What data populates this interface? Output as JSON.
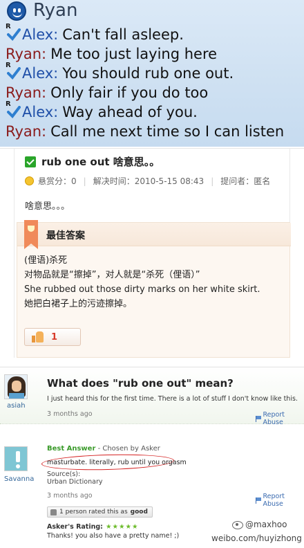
{
  "chat": {
    "title": "Ryan",
    "lines": [
      {
        "who": "Alex:",
        "text": "Can't fall asleep.",
        "verified": true
      },
      {
        "who": "Ryan:",
        "text": "Me too  just laying  here",
        "verified": false
      },
      {
        "who": "Alex:",
        "text": "You should rub one out.",
        "verified": true
      },
      {
        "who": "Ryan:",
        "text": "Only  fair  if  you  do  too",
        "verified": false
      },
      {
        "who": "Alex:",
        "text": "Way ahead  of  you.",
        "verified": true
      },
      {
        "who": "Ryan:",
        "text": "Call me next time so I can listen",
        "verified": false
      }
    ],
    "check_letter": "R",
    "colors": {
      "alex": "#1f4fa8",
      "ryan": "#8a1b1b",
      "background": "#cfe1f2"
    }
  },
  "baidu": {
    "question_title": "rub one out 啥意思。。",
    "bounty_label": "悬赏分：0",
    "solved_time": "解决时间：2010-5-15 08:43",
    "asker": "提问者：匿名",
    "question_body": "啥意思。。。",
    "best_answer_label": "最佳答案",
    "answer_lines": [
      "(俚语)杀死",
      "对物品就是“擦掉”，对人就是“杀死（俚语）”",
      "She rubbed out those dirty marks on her white skirt.",
      "她把白裙子上的污迹擦掉。"
    ],
    "like_count": "1",
    "colors": {
      "accent": "#d83b2b",
      "answer_bg": "#fdf7f1"
    }
  },
  "yahoo": {
    "asker_name": "asiah",
    "question_title": "What does \"rub one out\" mean?",
    "question_text": "I just heard this for the first time. There is a lot of stuff I don't know like this.",
    "question_date": "3 months ago",
    "report_label": "Report Abuse",
    "answerer_name": "Savanna",
    "best_answer_label": "Best Answer",
    "chosen_by": " - Chosen by Asker",
    "answer_text": "masturbate. literally, rub until you orgasm",
    "sources_label": "Source(s):",
    "sources_value": "Urban Dictionary",
    "answer_date": "3 months ago",
    "rated_prefix": "1 person rated this as",
    "rated_value": "good",
    "asker_rating_label": "Asker's Rating:",
    "stars": "★★★★★",
    "thanks_text": "Thanks! you also have a pretty name! ;)",
    "colors": {
      "best_answer": "#3a9a2a",
      "link": "#3b6bb0",
      "highlight_circle": "#d42020"
    }
  },
  "watermark": {
    "handle": "@maxhoo",
    "url": "weibo.com/huyizhong"
  }
}
